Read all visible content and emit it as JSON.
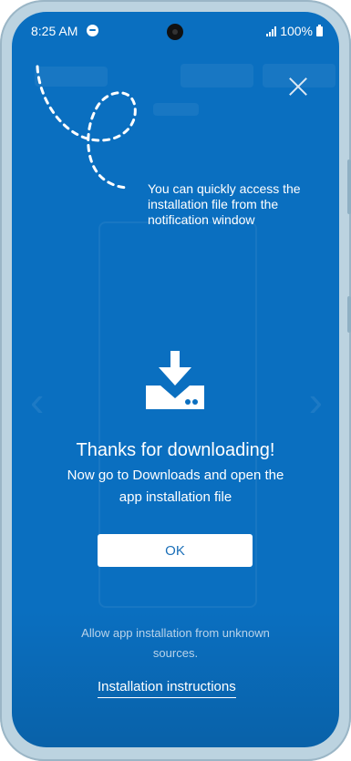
{
  "status_bar": {
    "time": "8:25 AM",
    "battery": "100%"
  },
  "overlay": {
    "hint": "You can quickly access the installation file from the notification window",
    "title": "Thanks for downloading!",
    "subtitle": "Now go to Downloads and open the app installation file",
    "ok_button": "OK",
    "unknown_sources_note": "Allow app installation from unknown sources.",
    "instructions_link": "Installation instructions"
  },
  "colors": {
    "background": "#0a6fc0",
    "button_text": "#1b6fb8"
  },
  "icons": [
    "spotify-icon",
    "signal-icon",
    "battery-icon",
    "close-icon",
    "download-icon"
  ]
}
